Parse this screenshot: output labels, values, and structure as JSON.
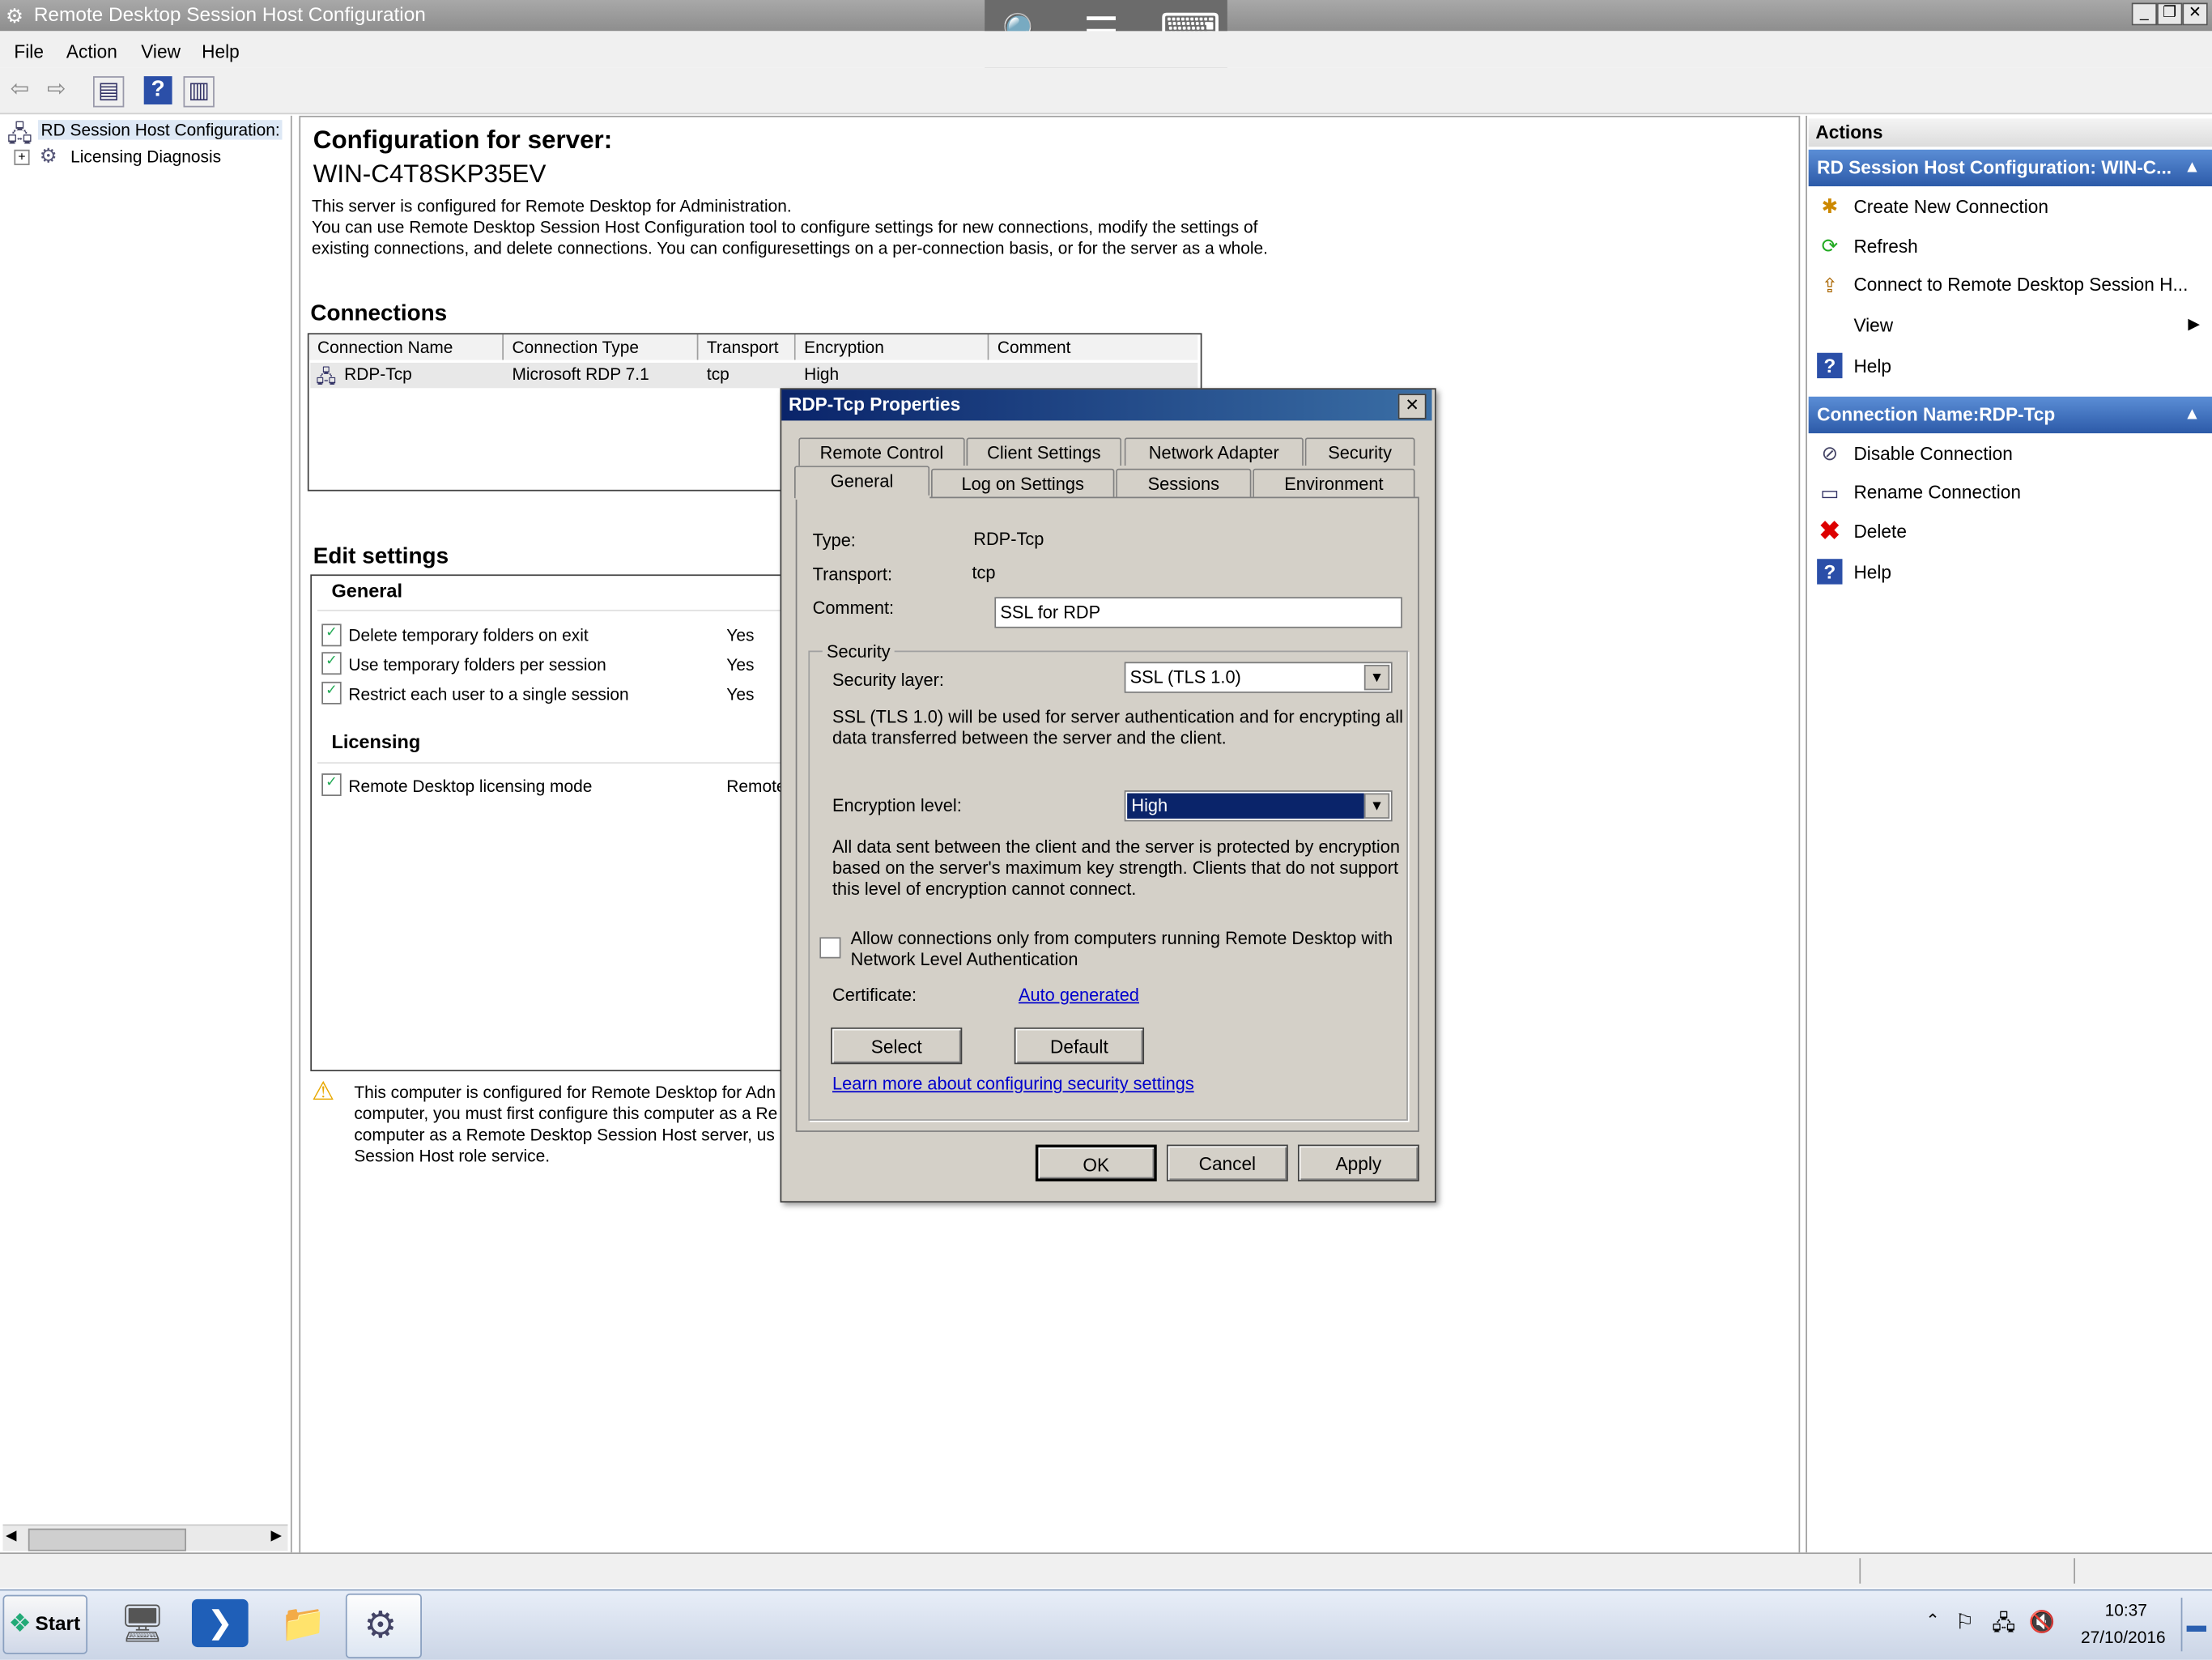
{
  "window": {
    "title": "Remote Desktop Session Host Configuration",
    "remote_bar": {
      "zoom_icon": "🔍",
      "menu_icon": "☰",
      "keyboard_icon": "⌨"
    }
  },
  "menu": [
    "File",
    "Action",
    "View",
    "Help"
  ],
  "tree": {
    "root": "RD Session Host Configuration:",
    "child": "Licensing Diagnosis"
  },
  "server": {
    "heading": "Configuration for server:",
    "name": "WIN-C4T8SKP35EV",
    "desc1": "This server is configured for Remote Desktop for Administration.",
    "desc2": "You can use Remote Desktop Session Host Configuration tool to configure settings for new connections, modify the settings of",
    "desc3": "existing connections, and delete connections. You can configuresettings on a per-connection basis, or for the server as a whole."
  },
  "connections": {
    "title": "Connections",
    "headers": [
      "Connection Name",
      "Connection Type",
      "Transport",
      "Encryption",
      "Comment"
    ],
    "row": {
      "name": "RDP-Tcp",
      "type": "Microsoft RDP 7.1",
      "transport": "tcp",
      "encryption": "High",
      "comment": ""
    }
  },
  "edit_settings": {
    "title": "Edit settings",
    "general_title": "General",
    "general_rows": [
      {
        "label": "Delete temporary folders on exit",
        "value": "Yes"
      },
      {
        "label": "Use temporary folders per session",
        "value": "Yes"
      },
      {
        "label": "Restrict each user to a single session",
        "value": "Yes"
      }
    ],
    "licensing_title": "Licensing",
    "licensing_row": {
      "label": "Remote Desktop licensing mode",
      "value": "Remote"
    }
  },
  "warning": {
    "l1": "This computer is configured for Remote Desktop for Adn",
    "l2": "computer, you must first configure this computer as a Re",
    "l3": "computer as a Remote Desktop Session Host server, us",
    "l4": "Session Host role service."
  },
  "actions": {
    "title": "Actions",
    "group1": "RD Session Host Configuration: WIN-C...",
    "group1_items": [
      "Create New Connection",
      "Refresh",
      "Connect to Remote Desktop Session H...",
      "View",
      "Help"
    ],
    "group2": "Connection Name:RDP-Tcp",
    "group2_items": [
      "Disable Connection",
      "Rename Connection",
      "Delete",
      "Help"
    ]
  },
  "dialog": {
    "title": "RDP-Tcp Properties",
    "tabs_back": [
      "Remote Control",
      "Client Settings",
      "Network Adapter",
      "Security"
    ],
    "tabs_front": [
      "General",
      "Log on Settings",
      "Sessions",
      "Environment"
    ],
    "type_label": "Type:",
    "type_value": "RDP-Tcp",
    "transport_label": "Transport:",
    "transport_value": "tcp",
    "comment_label": "Comment:",
    "comment_value": "SSL for RDP",
    "security_group": "Security",
    "security_layer_label": "Security layer:",
    "security_layer_value": "SSL (TLS 1.0)",
    "security_desc1": "SSL (TLS 1.0) will be used for server authentication and for encrypting all",
    "security_desc2": "data transferred between the server and the client.",
    "encryption_label": "Encryption level:",
    "encryption_value": "High",
    "enc_desc1": "All data sent between the client and the server is protected by encryption",
    "enc_desc2": "based on the server's maximum key strength. Clients that do not support",
    "enc_desc3": "this level of encryption cannot connect.",
    "nla_line1": "Allow connections only from computers running Remote Desktop with",
    "nla_line2": "Network Level Authentication",
    "nla_checked": false,
    "certificate_label": "Certificate:",
    "certificate_link": "Auto generated",
    "select_btn": "Select",
    "default_btn": "Default",
    "learn_link": "Learn more about configuring security settings",
    "ok": "OK",
    "cancel": "Cancel",
    "apply": "Apply"
  },
  "taskbar": {
    "start": "Start",
    "time": "10:37",
    "date": "27/10/2016"
  }
}
